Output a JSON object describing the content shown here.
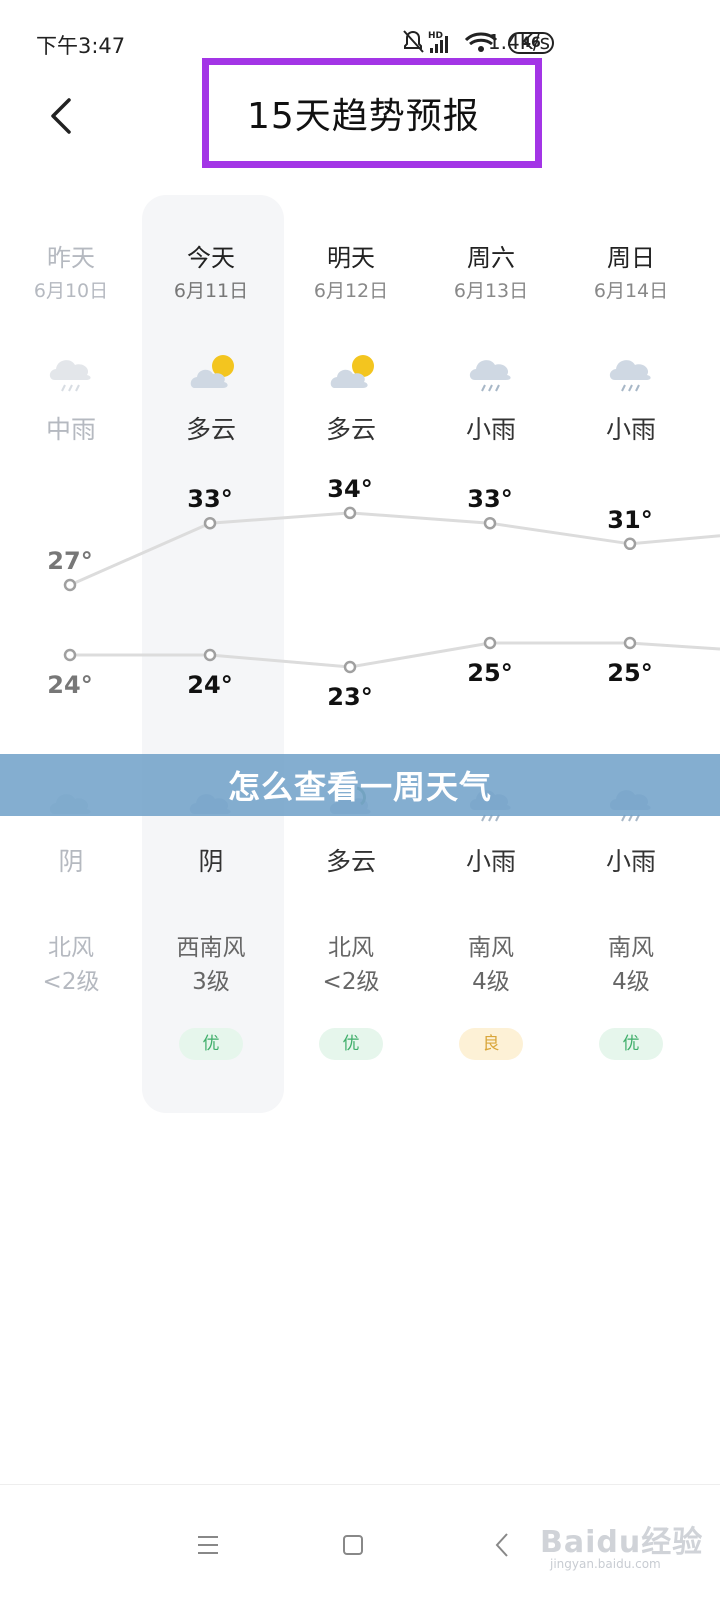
{
  "status_bar": {
    "time": "下午3:47",
    "net_speed": "1.4K/s",
    "hd_label": "HD",
    "battery": "46"
  },
  "header": {
    "title": "15天趋势预报"
  },
  "days": [
    {
      "label": "昨天",
      "date": "6月10日",
      "day_icon": "rain-cloud-icon",
      "day_cond": "中雨",
      "high": "27°",
      "low": "24°",
      "night_icon": "cloud-icon",
      "night_cond": "阴",
      "wind_dir": "北风",
      "wind_level": "<2级",
      "aqi": ""
    },
    {
      "label": "今天",
      "date": "6月11日",
      "day_icon": "partly-cloudy-icon",
      "day_cond": "多云",
      "high": "33°",
      "low": "24°",
      "night_icon": "cloud-icon",
      "night_cond": "阴",
      "wind_dir": "西南风",
      "wind_level": "3级",
      "aqi": "优"
    },
    {
      "label": "明天",
      "date": "6月12日",
      "day_icon": "partly-cloudy-icon",
      "day_cond": "多云",
      "high": "34°",
      "low": "23°",
      "night_icon": "partly-cloudy-night-icon",
      "night_cond": "多云",
      "wind_dir": "北风",
      "wind_level": "<2级",
      "aqi": "优"
    },
    {
      "label": "周六",
      "date": "6月13日",
      "day_icon": "rain-cloud-icon",
      "day_cond": "小雨",
      "high": "33°",
      "low": "25°",
      "night_icon": "rain-cloud-icon",
      "night_cond": "小雨",
      "wind_dir": "南风",
      "wind_level": "4级",
      "aqi": "良"
    },
    {
      "label": "周日",
      "date": "6月14日",
      "day_icon": "rain-cloud-icon",
      "day_cond": "小雨",
      "high": "31°",
      "low": "25°",
      "night_icon": "rain-cloud-icon",
      "night_cond": "小雨",
      "wind_dir": "南风",
      "wind_level": "4级",
      "aqi": "优"
    }
  ],
  "temps": {
    "highs": [
      27,
      33,
      34,
      33,
      31
    ],
    "lows": [
      24,
      24,
      23,
      25,
      25
    ]
  },
  "banner": {
    "text": "怎么查看一周天气"
  },
  "watermark": {
    "text": "Baidu经验",
    "url": "jingyan.baidu.com"
  },
  "colors": {
    "accent_border": "#a335e6",
    "line": "#dcdcdc",
    "aqi_good": "#3fae6a",
    "aqi_fair": "#d9a63a"
  }
}
